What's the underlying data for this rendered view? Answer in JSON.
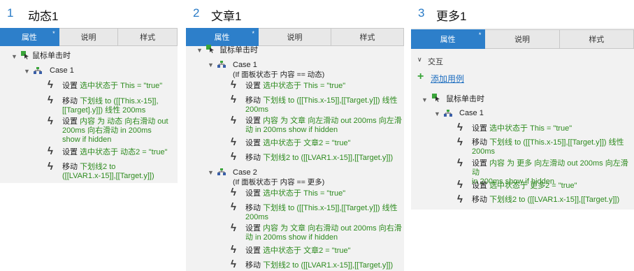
{
  "tabs": [
    "属性",
    "说明",
    "样式"
  ],
  "event_label": "鼠标单击时",
  "panels": [
    {
      "number": "1",
      "title": "动态1",
      "case": "Case 1",
      "actions": [
        {
          "verb": "设置",
          "line1": "选中状态于 This = \"true\"",
          "line2": "",
          "line3": ""
        },
        {
          "verb": "移动",
          "line1": "下划线 to ([[This.x-15]],",
          "line2": "[[Target].y]]) 线性 200ms",
          "line3": ""
        },
        {
          "verb": "设置",
          "line1": "内容 为 动态 向右滑动 out",
          "line2": "200ms 向右滑动 in 200ms",
          "line3": "show if hidden"
        },
        {
          "verb": "设置",
          "line1": "选中状态于 动态2 = \"true\"",
          "line2": "",
          "line3": ""
        },
        {
          "verb": "移动",
          "line1": "下划线2 to",
          "line2": "([[LVAR1.x-15]],[[Target.y]])",
          "line3": ""
        }
      ]
    },
    {
      "number": "2",
      "title": "文章1",
      "cases": [
        {
          "name": "Case 1",
          "condition": "(If 面板状态于 内容 == 动态)",
          "actions": [
            {
              "verb": "设置",
              "line1": "选中状态于 This = \"true\"",
              "line2": ""
            },
            {
              "verb": "移动",
              "line1": "下划线 to ([[This.x-15]],[[Target.y]]) 线性",
              "line2": "200ms"
            },
            {
              "verb": "设置",
              "line1": "内容 为 文章 向左滑动 out 200ms 向左滑",
              "line2": "动 in 200ms show if hidden"
            },
            {
              "verb": "设置",
              "line1": "选中状态于 文章2 = \"true\"",
              "line2": ""
            },
            {
              "verb": "移动",
              "line1": "下划线2 to ([[LVAR1.x-15]],[[Target.y]])",
              "line2": ""
            }
          ]
        },
        {
          "name": "Case 2",
          "condition": "(If 面板状态于 内容 == 更多)",
          "actions": [
            {
              "verb": "设置",
              "line1": "选中状态于 This = \"true\"",
              "line2": ""
            },
            {
              "verb": "移动",
              "line1": "下划线 to ([[This.x-15]],[[Target.y]]) 线性",
              "line2": "200ms"
            },
            {
              "verb": "设置",
              "line1": "内容 为 文章 向右滑动 out 200ms 向右滑",
              "line2": "动 in 200ms show if hidden"
            },
            {
              "verb": "设置",
              "line1": "选中状态于 文章2 = \"true\"",
              "line2": ""
            },
            {
              "verb": "移动",
              "line1": "下划线2 to ([[LVAR1.x-15]],[[Target.y]])",
              "line2": ""
            }
          ]
        }
      ]
    },
    {
      "number": "3",
      "title": "更多1",
      "section": "交互",
      "add_case": "添加用例",
      "case": "Case 1",
      "actions": [
        {
          "verb": "设置",
          "line1": "选中状态于 This = \"true\"",
          "line2": ""
        },
        {
          "verb": "移动",
          "line1": "下划线 to ([[This.x-15]],[[Target.y]]) 线性",
          "line2": "200ms"
        },
        {
          "verb": "设置",
          "line1": "内容 为 更多 向左滑动 out 200ms 向左滑动",
          "line2": "in 200ms show if hidden"
        },
        {
          "verb": "设置",
          "line1": "选中状态于 更多2 = \"true\"",
          "line2": ""
        },
        {
          "verb": "移动",
          "line1": "下划线2 to ([[LVAR1.x-15]],[[Target.y]])",
          "line2": ""
        }
      ]
    }
  ],
  "colors": {
    "accent": "#2d7fca",
    "number": "#2a7cc7",
    "value_text": "#2e8b1f",
    "event_icon": "#3aa53a"
  }
}
